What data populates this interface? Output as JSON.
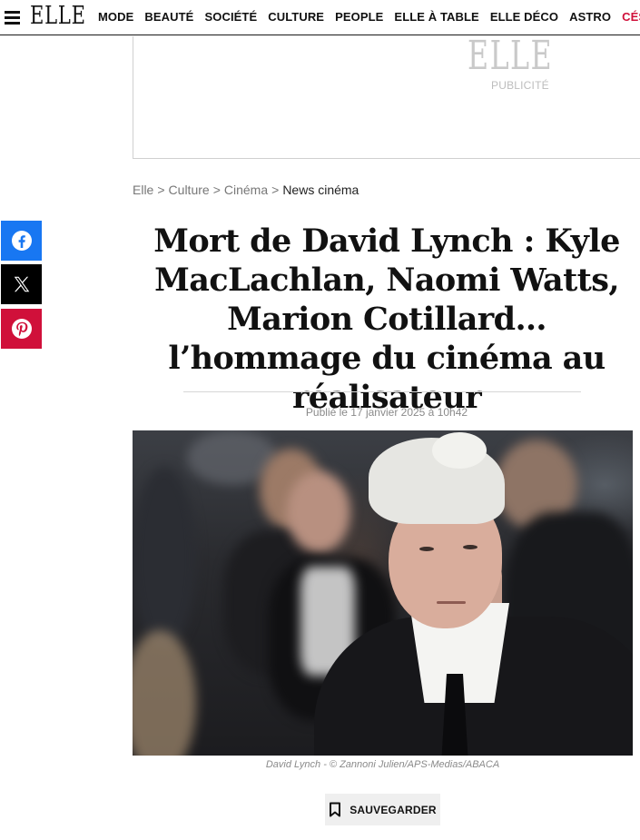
{
  "header": {
    "logo": "ELLE",
    "nav": [
      "MODE",
      "BEAUTÉ",
      "SOCIÉTÉ",
      "CULTURE",
      "PEOPLE",
      "ELLE À TABLE",
      "ELLE DÉCO",
      "ASTRO",
      "CÉSA"
    ],
    "accent_color": "#d0103a"
  },
  "ad": {
    "logo": "ELLE",
    "label": "PUBLICITÉ"
  },
  "breadcrumb": [
    "Elle",
    "Culture",
    "Cinéma",
    "News cinéma"
  ],
  "share": [
    {
      "icon": "facebook-icon",
      "color": "#1877f2"
    },
    {
      "icon": "x-icon",
      "color": "#000000"
    },
    {
      "icon": "pinterest-icon",
      "color": "#d0103a"
    }
  ],
  "article": {
    "title": "Mort de David Lynch : Kyle MacLachlan, Naomi Watts, Marion Cotillard… l’hommage du cinéma au réalisateur",
    "published": "Publié le 17 janvier 2025 à 10h42",
    "image_caption": "David Lynch - © Zannoni Julien/APS-Medias/ABACA",
    "save_label": "SAUVEGARDER"
  }
}
